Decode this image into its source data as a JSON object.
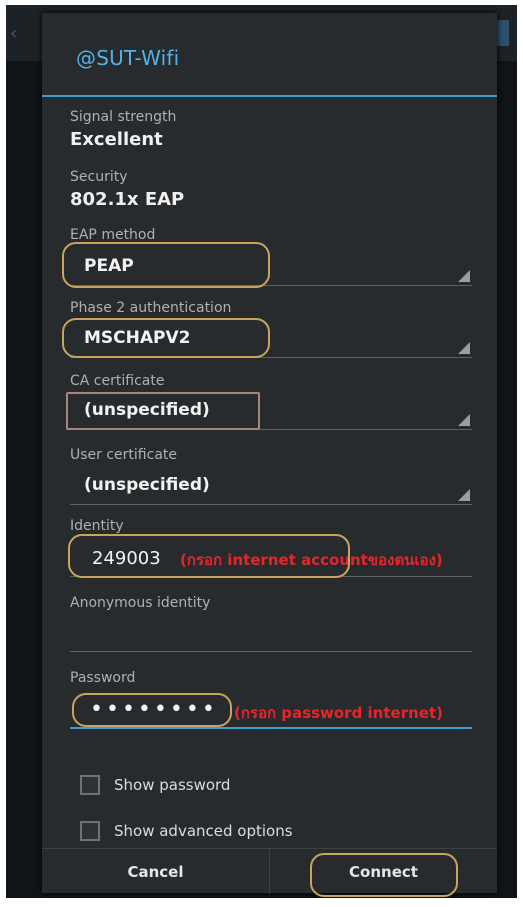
{
  "dialog": {
    "title": "@SUT-Wifi",
    "signal": {
      "label": "Signal strength",
      "value": "Excellent"
    },
    "security": {
      "label": "Security",
      "value": "802.1x EAP"
    },
    "eap_method": {
      "label": "EAP method",
      "value": "PEAP"
    },
    "phase2": {
      "label": "Phase 2 authentication",
      "value": "MSCHAPV2"
    },
    "ca_cert": {
      "label": "CA certificate",
      "value": "(unspecified)"
    },
    "user_cert": {
      "label": "User certificate",
      "value": "(unspecified)"
    },
    "identity": {
      "label": "Identity",
      "value": "249003",
      "note": "(กรอก internet accountของตนเอง)"
    },
    "anonymous": {
      "label": "Anonymous identity",
      "value": ""
    },
    "password": {
      "label": "Password",
      "value": "••••••••",
      "note": "(กรอก password internet)"
    },
    "show_password": "Show password",
    "show_advanced": "Show advanced options",
    "cancel": "Cancel",
    "connect": "Connect"
  },
  "colors": {
    "accent": "#3a9fd0",
    "highlight": "#c7a55a",
    "note": "#e8242b"
  }
}
